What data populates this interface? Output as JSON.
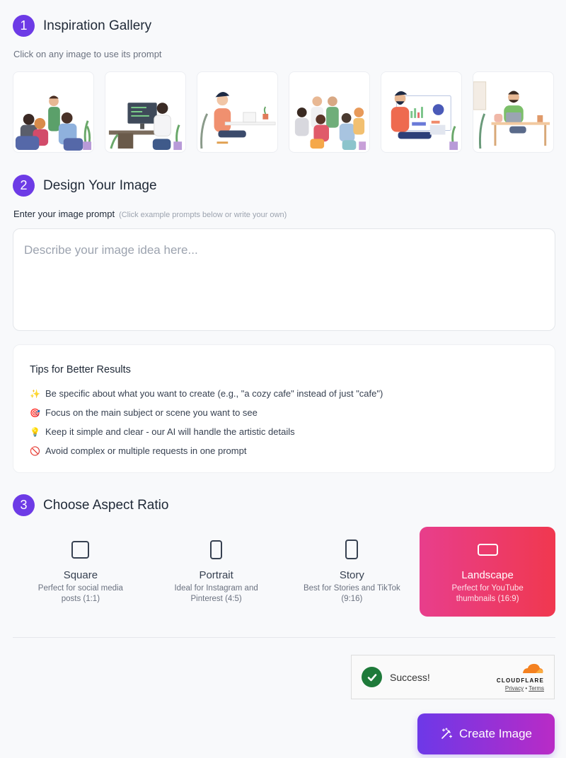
{
  "sections": {
    "gallery": {
      "step": "1",
      "title": "Inspiration Gallery",
      "subtitle": "Click on any image to use its prompt"
    },
    "design": {
      "step": "2",
      "title": "Design Your Image"
    },
    "ratio": {
      "step": "3",
      "title": "Choose Aspect Ratio"
    }
  },
  "gallery": {
    "images": [
      {
        "name": "team-meeting-illustration"
      },
      {
        "name": "developer-at-computer-illustration"
      },
      {
        "name": "woman-writing-at-desk-illustration"
      },
      {
        "name": "group-discussion-illustration"
      },
      {
        "name": "analyst-with-dashboard-illustration"
      },
      {
        "name": "man-with-laptop-illustration"
      }
    ]
  },
  "prompt": {
    "label": "Enter your image prompt",
    "hint": "(Click example prompts below or write your own)",
    "placeholder": "Describe your image idea here...",
    "value": ""
  },
  "tips": {
    "title": "Tips for Better Results",
    "items": [
      {
        "icon": "✨",
        "icon_name": "sparkles-icon",
        "text": "Be specific about what you want to create (e.g., \"a cozy cafe\" instead of just \"cafe\")"
      },
      {
        "icon": "🎯",
        "icon_name": "target-icon",
        "text": "Focus on the main subject or scene you want to see"
      },
      {
        "icon": "💡",
        "icon_name": "lightbulb-icon",
        "text": "Keep it simple and clear - our AI will handle the artistic details"
      },
      {
        "icon": "🚫",
        "icon_name": "prohibited-icon",
        "text": "Avoid complex or multiple requests in one prompt"
      }
    ]
  },
  "ratios": [
    {
      "name": "Square",
      "desc": "Perfect for social media posts (1:1)",
      "selected": false
    },
    {
      "name": "Portrait",
      "desc": "Ideal for Instagram and Pinterest (4:5)",
      "selected": false
    },
    {
      "name": "Story",
      "desc": "Best for Stories and TikTok (9:16)",
      "selected": false
    },
    {
      "name": "Landscape",
      "desc": "Perfect for YouTube thumbnails (16:9)",
      "selected": true
    }
  ],
  "captcha": {
    "status": "Success!",
    "brand": "CLOUDFLARE",
    "privacy": "Privacy",
    "separator": "•",
    "terms": "Terms"
  },
  "create_button": {
    "label": "Create Image"
  },
  "colors": {
    "accent": "#6d3be6",
    "selected_ratio": "#ec3c6b",
    "success": "#1e7a3a"
  }
}
